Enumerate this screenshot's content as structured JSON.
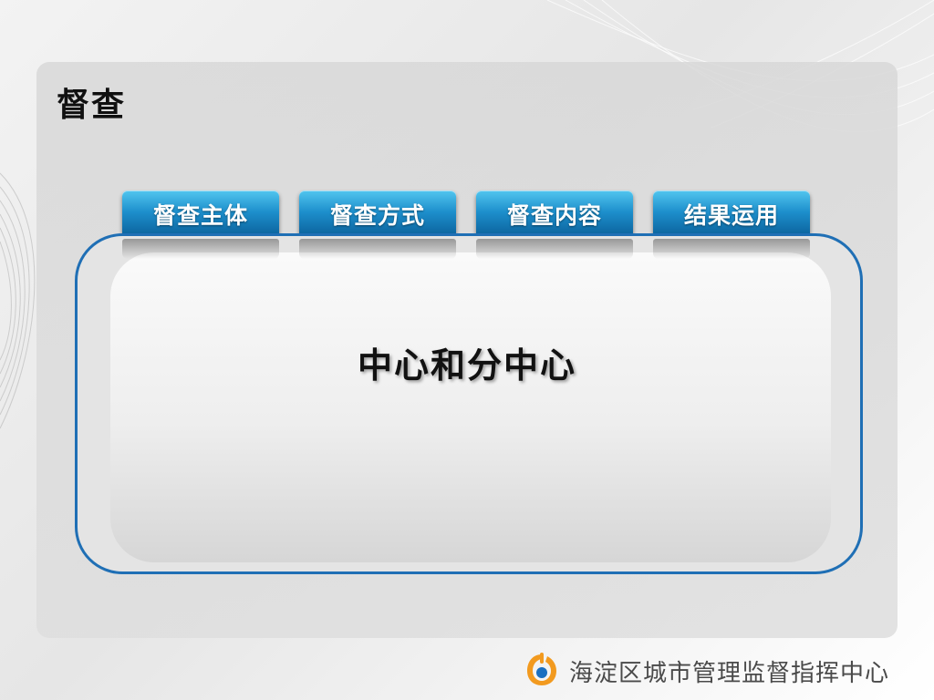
{
  "title": "督查",
  "tabs": [
    {
      "label": "督查主体"
    },
    {
      "label": "督查方式"
    },
    {
      "label": "督查内容"
    },
    {
      "label": "结果运用"
    }
  ],
  "content": {
    "text": "中心和分中心"
  },
  "footer": {
    "org_name": "海淀区城市管理监督指挥中心",
    "logo_icon": "haidian-logo-icon"
  },
  "colors": {
    "tab_top": "#52c6ef",
    "tab_bottom": "#0a5f99",
    "frame_border": "#1f6fb5",
    "logo_orange": "#f29a1f",
    "logo_blue": "#1a6fc0"
  }
}
